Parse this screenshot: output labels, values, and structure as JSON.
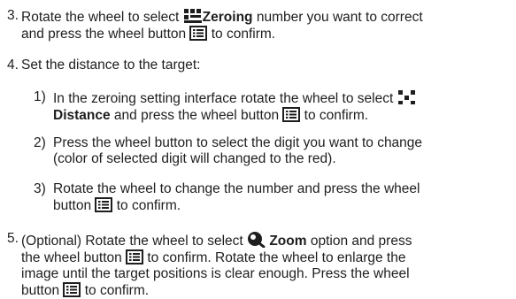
{
  "step3": {
    "number": "3.",
    "line1_a": "Rotate the wheel to select ",
    "line1_bold": "Zeroing",
    "line1_b": " number you want to correct",
    "line2_a": "and press the wheel button ",
    "line2_b": " to confirm."
  },
  "step4": {
    "number": "4.",
    "text": "Set the distance to the target:",
    "sub1": {
      "number": "1)",
      "line1": "In the zeroing setting interface rotate the wheel to select ",
      "line2_bold": "Distance",
      "line2_a": " and press the wheel button ",
      "line2_b": " to confirm."
    },
    "sub2": {
      "number": "2)",
      "line1": "Press the wheel button to select the digit you want to change",
      "line2": "(color of selected digit will changed to the red)."
    },
    "sub3": {
      "number": "3)",
      "line1": "Rotate the wheel to change the number and press the wheel",
      "line2_a": "button ",
      "line2_b": " to confirm."
    }
  },
  "step5": {
    "number": "5.",
    "line1_a": "(Optional) Rotate the wheel to select ",
    "line1_bold": "Zoom",
    "line1_b": " option and press",
    "line2_a": "the wheel button ",
    "line2_b": " to confirm. Rotate the wheel to enlarge the",
    "line3": "image until the target positions is clear enough. Press the wheel",
    "line4_a": "button ",
    "line4_b": " to confirm."
  },
  "icons": {
    "zeroing": "zeroing-icon",
    "distance": "distance-icon",
    "menu_button": "menu-button-icon",
    "zoom": "zoom-icon"
  },
  "colors": {
    "text": "#1e1e1e",
    "icon": "#1e1e1e"
  }
}
